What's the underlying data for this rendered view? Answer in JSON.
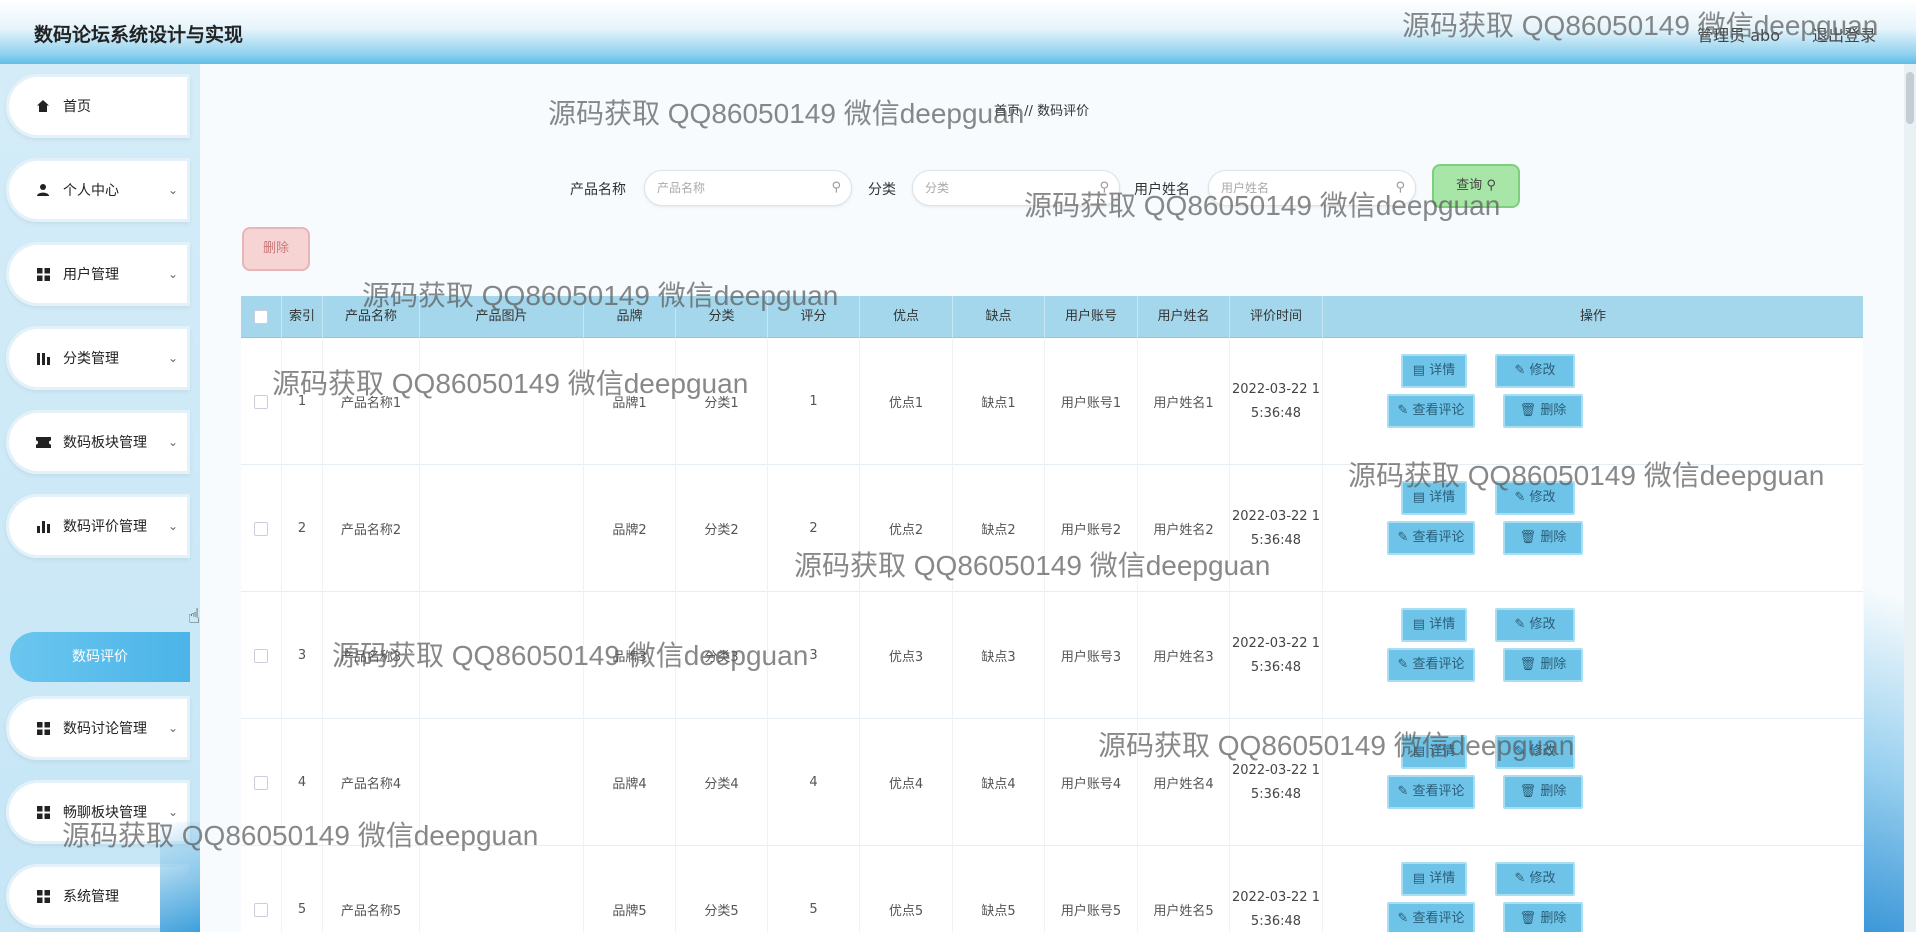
{
  "header": {
    "title": "数码论坛系统设计与实现",
    "user": "管理员 abo",
    "logout": "退出登录"
  },
  "sidebar": {
    "items": [
      {
        "label": "首页",
        "icon": "home-icon",
        "chevron": false
      },
      {
        "label": "个人中心",
        "icon": "person-icon",
        "chevron": true
      },
      {
        "label": "用户管理",
        "icon": "grid-icon",
        "chevron": true
      },
      {
        "label": "分类管理",
        "icon": "bar-icon",
        "chevron": true
      },
      {
        "label": "数码板块管理",
        "icon": "ticket-icon",
        "chevron": true
      },
      {
        "label": "数码评价管理",
        "icon": "chart-icon",
        "chevron": true
      },
      {
        "label": "数码讨论管理",
        "icon": "grid-icon",
        "chevron": true
      },
      {
        "label": "畅聊板块管理",
        "icon": "grid-icon",
        "chevron": true
      },
      {
        "label": "系统管理",
        "icon": "grid-icon",
        "chevron": false
      }
    ],
    "active_sub": "数码评价"
  },
  "breadcrumb": {
    "home": "首页",
    "sep": "//",
    "current": "数码评价"
  },
  "search": {
    "product_label": "产品名称",
    "product_placeholder": "产品名称",
    "category_label": "分类",
    "category_placeholder": "分类",
    "username_label": "用户姓名",
    "username_placeholder": "用户姓名",
    "query_label": "查询"
  },
  "delete_label": "删除",
  "table": {
    "headers": [
      "索引",
      "产品名称",
      "产品图片",
      "品牌",
      "分类",
      "评分",
      "优点",
      "缺点",
      "用户账号",
      "用户姓名",
      "评价时间",
      "操作"
    ],
    "rows": [
      {
        "index": "1",
        "name": "产品名称1",
        "brand": "品牌1",
        "category": "分类1",
        "score": "1",
        "pros": "优点1",
        "cons": "缺点1",
        "account": "用户账号1",
        "username": "用户姓名1",
        "time1": "2022-03-22 1",
        "time2": "5:36:48"
      },
      {
        "index": "2",
        "name": "产品名称2",
        "brand": "品牌2",
        "category": "分类2",
        "score": "2",
        "pros": "优点2",
        "cons": "缺点2",
        "account": "用户账号2",
        "username": "用户姓名2",
        "time1": "2022-03-22 1",
        "time2": "5:36:48"
      },
      {
        "index": "3",
        "name": "产品名称3",
        "brand": "品牌3",
        "category": "分类3",
        "score": "3",
        "pros": "优点3",
        "cons": "缺点3",
        "account": "用户账号3",
        "username": "用户姓名3",
        "time1": "2022-03-22 1",
        "time2": "5:36:48"
      },
      {
        "index": "4",
        "name": "产品名称4",
        "brand": "品牌4",
        "category": "分类4",
        "score": "4",
        "pros": "优点4",
        "cons": "缺点4",
        "account": "用户账号4",
        "username": "用户姓名4",
        "time1": "2022-03-22 1",
        "time2": "5:36:48"
      },
      {
        "index": "5",
        "name": "产品名称5",
        "brand": "品牌5",
        "category": "分类5",
        "score": "5",
        "pros": "优点5",
        "cons": "缺点5",
        "account": "用户账号5",
        "username": "用户姓名5",
        "time1": "2022-03-22 1",
        "time2": "5:36:48"
      }
    ],
    "actions": {
      "detail": "详情",
      "edit": "修改",
      "view_comments": "查看评论",
      "delete": "删除"
    }
  },
  "watermark": "源码获取 QQ86050149 微信deepguan",
  "colors": {
    "header_blue": "#5fbde6",
    "table_header": "#a4d7ec",
    "action_button": "#6ec4e8",
    "query_button": "#a8e6a8",
    "delete_button": "#f7d4d4"
  }
}
